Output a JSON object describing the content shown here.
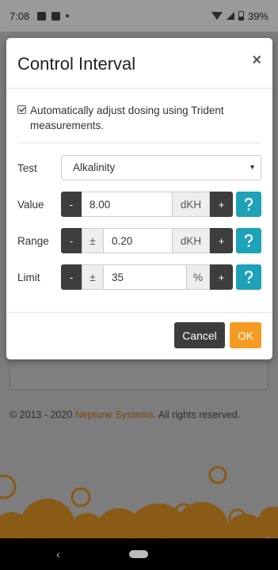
{
  "status_bar": {
    "time": "7:08",
    "battery": "39%"
  },
  "background": {
    "copyright_prefix": "© 2013 - 2020 ",
    "copyright_brand": "Neptune Systems",
    "copyright_suffix": ". All rights reserved."
  },
  "modal": {
    "title": "Control Interval",
    "close": "×",
    "auto_adjust": {
      "checked": true,
      "label": "Automatically adjust dosing using Trident measurements."
    },
    "test": {
      "label": "Test",
      "selected": "Alkalinity"
    },
    "value": {
      "label": "Value",
      "minus": "-",
      "input": "8.00",
      "unit": "dKH",
      "plus": "+"
    },
    "range": {
      "label": "Range",
      "minus": "-",
      "pm": "±",
      "input": "0.20",
      "unit": "dKH",
      "plus": "+"
    },
    "limit": {
      "label": "Limit",
      "minus": "-",
      "pm": "±",
      "input": "35",
      "unit": "%",
      "plus": "+"
    },
    "cancel_label": "Cancel",
    "ok_label": "OK"
  },
  "colors": {
    "accent_orange": "#f59a23",
    "help_teal": "#1ea2b8",
    "dark_button": "#3d3d3d"
  }
}
